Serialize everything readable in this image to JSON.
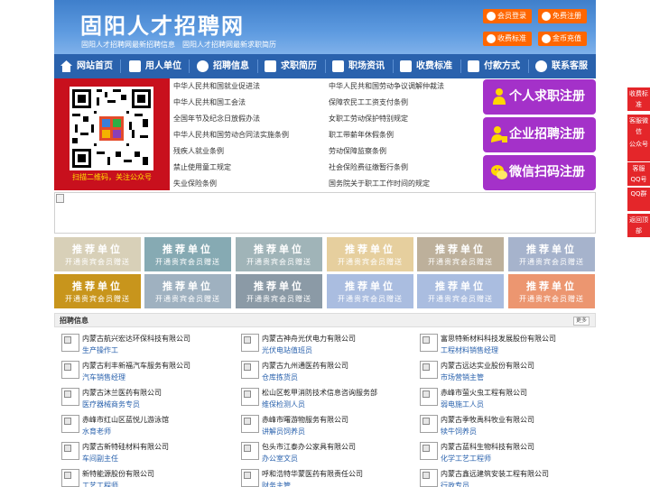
{
  "header": {
    "title": "固阳人才招聘网",
    "subtitle": "固阳人才招聘网最新招聘信息　固阳人才招聘网最新求职简历",
    "buttons": {
      "member_login": "会员登录",
      "free_register": "免费注册",
      "fee_standard": "收费标准",
      "coin_recharge": "金币充值"
    }
  },
  "nav": [
    "网站首页",
    "用人单位",
    "招聘信息",
    "求职简历",
    "职场资讯",
    "收费标准",
    "付款方式",
    "联系客服"
  ],
  "qr": {
    "caption": "扫描二维码，关注公众号"
  },
  "laws_left": [
    "中华人民共和国就业促进法",
    "中华人民共和国工会法",
    "全国年节及纪念日放假办法",
    "中华人民共和国劳动合同法实施条例",
    "残疾人就业条例",
    "禁止使用童工规定",
    "失业保险条例"
  ],
  "laws_right": [
    "中华人民共和国劳动争议调解仲裁法",
    "保障农民工工资支付条例",
    "女职工劳动保护特别规定",
    "职工带薪年休假条例",
    "劳动保障监察条例",
    "社会保险费征缴暂行条例",
    "国务院关于职工工作时间的规定"
  ],
  "register": {
    "job_seeker": "个人求职注册",
    "company": "企业招聘注册",
    "wechat": "微信扫码注册"
  },
  "side_bar": [
    "收费标准",
    "客服微信",
    "公众号",
    "客服QQ号",
    "QQ群",
    "返回顶部"
  ],
  "recommend": {
    "title": "推荐单位",
    "subtitle": "开通贵宾会员赠送",
    "colors_row1": [
      "#d8d0b8",
      "#86aab3",
      "#a0b4b8",
      "#e6cf9e",
      "#bdb09b",
      "#a6b3cc"
    ],
    "colors_row2": [
      "#c8951c",
      "#9fb1c0",
      "#8b9aa6",
      "#aabde0",
      "#aabde0",
      "#ec9670"
    ]
  },
  "jobs": {
    "title": "招聘信息",
    "more": "更多",
    "col1": [
      {
        "company": "内蒙古航兴宏达环保科技有限公司",
        "position": "生产操作工"
      },
      {
        "company": "内蒙古利丰新福汽车服务有限公司",
        "position": "汽车销售经理"
      },
      {
        "company": "内蒙古沐兰医药有限公司",
        "position": "医疗器械商务专员"
      },
      {
        "company": "赤峰市红山区蓝悦儿游泳馆",
        "position": "水育老师"
      },
      {
        "company": "内蒙古新特硅材料有限公司",
        "position": "车间副主任"
      },
      {
        "company": "新特能源股份有限公司",
        "position": "工艺工程师"
      }
    ],
    "col2": [
      {
        "company": "内蒙古神舟光伏电力有限公司",
        "position": "光伏电站值班员"
      },
      {
        "company": "内蒙古九州通医药有限公司",
        "position": "仓库拣货员"
      },
      {
        "company": "松山区乾甲消防技术信息咨询服务部",
        "position": "维保检测人员"
      },
      {
        "company": "赤峰市曙游物服务有限公司",
        "position": "讲解员饲养员"
      },
      {
        "company": "包头市江泰办公家具有限公司",
        "position": "办公室文员"
      },
      {
        "company": "呼和浩特华蒙医药有限责任公司",
        "position": "财务主管"
      }
    ],
    "col3": [
      {
        "company": "富思特新材料科技发展股份有限公司",
        "position": "工程材料销售经理"
      },
      {
        "company": "内蒙古远达实业股份有限公司",
        "position": "市场营销主管"
      },
      {
        "company": "赤峰市萤火虫工程有限公司",
        "position": "弱电施工人员"
      },
      {
        "company": "内蒙古季牧禹科牧业有限公司",
        "position": "犊牛饲养员"
      },
      {
        "company": "内蒙古蓝科生物科技有限公司",
        "position": "化学工艺工程师"
      },
      {
        "company": "内蒙古鑫远建筑安装工程有限公司",
        "position": "行政专员"
      }
    ]
  }
}
